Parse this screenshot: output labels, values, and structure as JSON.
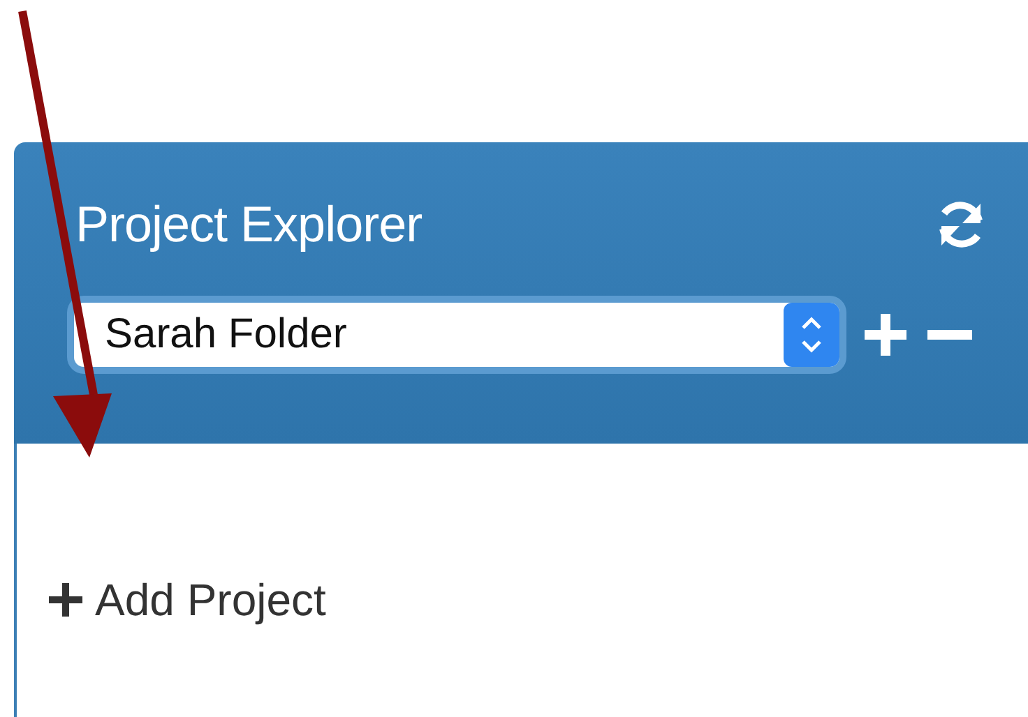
{
  "panel": {
    "title": "Project Explorer",
    "folder_select": {
      "value": "Sarah Folder"
    },
    "add_project": {
      "label": "Add Project"
    }
  }
}
